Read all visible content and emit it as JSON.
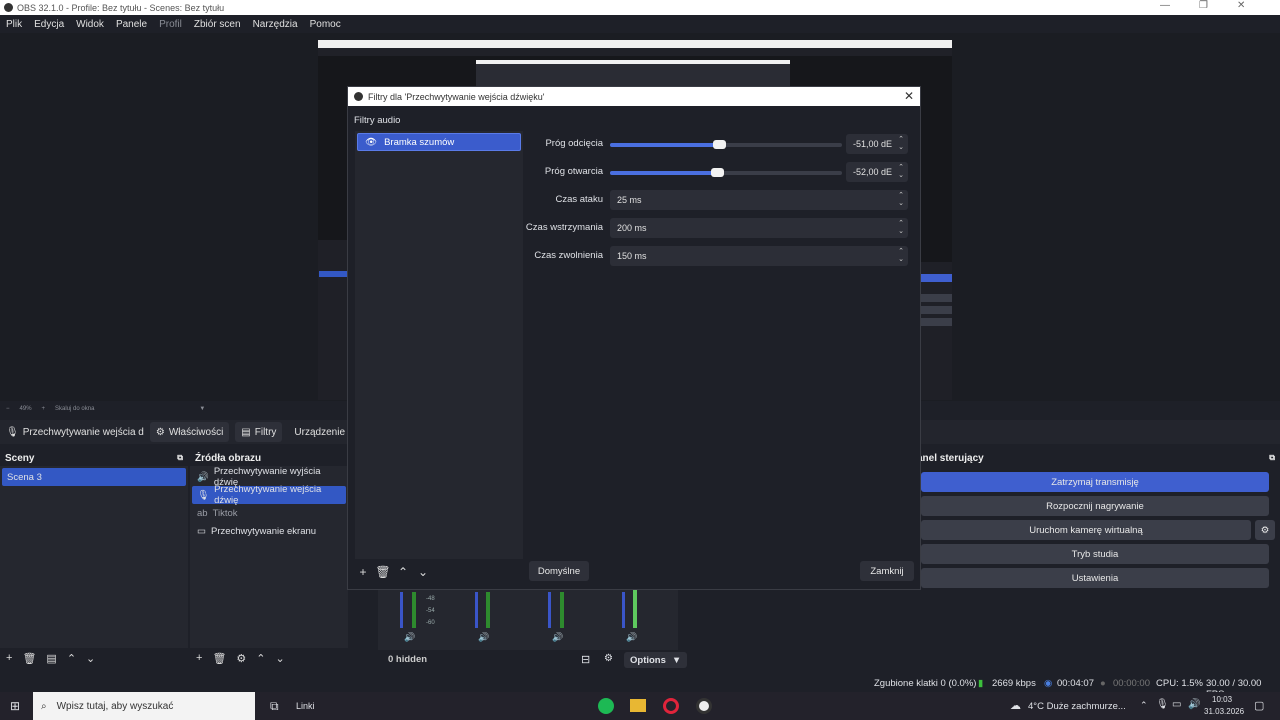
{
  "window": {
    "title": "OBS 32.1.0 - Profile: Bez tytułu - Scenes: Bez tytułu"
  },
  "menu": [
    "Plik",
    "Edycja",
    "Widok",
    "Panele",
    "Profil",
    "Zbiór scen",
    "Narzędzia",
    "Pomoc"
  ],
  "preview": {
    "zoom": "49%",
    "scale_mode": "Skaluj do okna"
  },
  "source_toolbar": {
    "source_name": "Przechwytywanie wejścia d",
    "properties": "Właściwości",
    "filters": "Filtry",
    "device": "Urządzenie",
    "overflow": "M"
  },
  "scenes": {
    "title": "Sceny",
    "items": [
      "Scena 3"
    ]
  },
  "sources": {
    "title": "Źródła obrazu",
    "items": [
      "Przechwytywanie wyjścia dźwię",
      "Przechwytywanie wejścia dźwię",
      "Tiktok",
      "Przechwytywanie ekranu"
    ]
  },
  "mixer": {
    "hidden": "0 hidden",
    "options": "Options",
    "ticks": [
      "-48",
      "-54",
      "-60"
    ]
  },
  "controls": {
    "title": "anel sterujący",
    "stop_stream": "Zatrzymaj transmisję",
    "start_record": "Rozpocznij nagrywanie",
    "virtual_cam": "Uruchom kamerę wirtualną",
    "studio": "Tryb studia",
    "settings": "Ustawienia"
  },
  "status": {
    "dropped": "Zgubione klatki 0 (0.0%)",
    "bitrate": "2669 kbps",
    "stream_time": "00:04:07",
    "record_time": "00:00:00",
    "cpu": "CPU: 1.5%",
    "fps": "30.00 / 30.00 FPS"
  },
  "taskbar": {
    "search": "Wpisz tutaj, aby wyszukać",
    "links": "Linki",
    "weather": "4°C  Duże zachmurze...",
    "time": "10:03",
    "date": "31.03.2026"
  },
  "dialog": {
    "title": "Filtry dla 'Przechwytywanie wejścia dźwięku'",
    "section": "Filtry audio",
    "filter": "Bramka szumów",
    "close_threshold_label": "Próg odcięcia",
    "close_threshold": "-51,00 dE",
    "close_threshold_fraction": 0.47,
    "open_threshold_label": "Próg otwarcia",
    "open_threshold": "-52,00 dE",
    "open_threshold_fraction": 0.46,
    "attack_label": "Czas ataku",
    "attack": "25 ms",
    "hold_label": "Czas wstrzymania",
    "hold": "200 ms",
    "release_label": "Czas zwolnienia",
    "release": "150 ms",
    "defaults": "Domyślne",
    "close": "Zamknij"
  }
}
